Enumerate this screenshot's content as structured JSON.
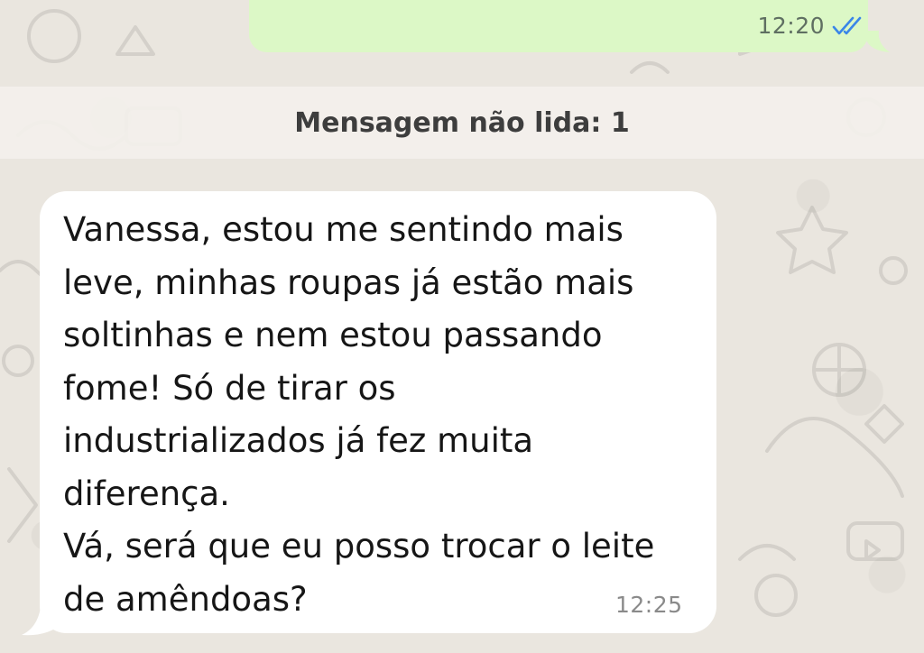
{
  "outgoing_message": {
    "time": "12:20",
    "status_icon": "double-check-read-icon",
    "status_color": "#3a86e8"
  },
  "unread_banner": {
    "text": "Mensagem não lida: 1"
  },
  "incoming_message": {
    "lines": [
      "Vanessa, estou me sentindo mais",
      "leve, minhas roupas já estão mais",
      "soltinhas e nem estou passando",
      "fome! Só de tirar os",
      "industrializados já fez muita",
      "diferença.",
      "Vá, será que eu posso trocar o leite",
      "de amêndoas?"
    ],
    "time": "12:25"
  },
  "colors": {
    "wallpaper": "#eae6df",
    "outgoing_bubble": "#dcf8c6",
    "incoming_bubble": "#ffffff",
    "banner": "#f3f0eb"
  }
}
